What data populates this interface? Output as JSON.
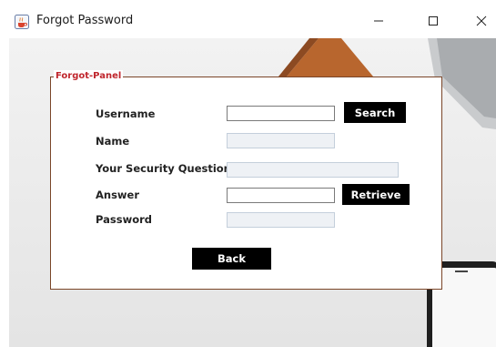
{
  "window": {
    "title": "Forgot Password",
    "icon": "java-cup-icon"
  },
  "panel": {
    "legend": "Forgot-Panel"
  },
  "form": {
    "username_label": "Username",
    "username_value": "",
    "name_label": "Name",
    "name_value": "",
    "security_question_label": "Your Security Question",
    "security_question_value": "",
    "answer_label": "Answer",
    "answer_value": "",
    "password_label": "Password",
    "password_value": ""
  },
  "buttons": {
    "search": "Search",
    "retrieve": "Retrieve",
    "back": "Back"
  },
  "colors": {
    "legend_text": "#c0262d",
    "panel_border": "#7a4528",
    "button_bg": "#000000",
    "button_text": "#ffffff"
  }
}
